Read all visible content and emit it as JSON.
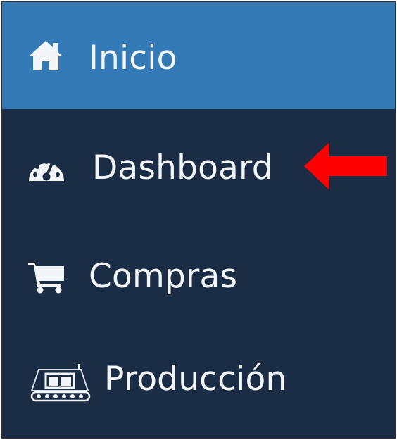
{
  "sidebar": {
    "items": [
      {
        "label": "Inicio",
        "icon": "home-icon",
        "active": true
      },
      {
        "label": "Dashboard",
        "icon": "dashboard-gauge-icon",
        "active": false
      },
      {
        "label": "Compras",
        "icon": "shopping-cart-icon",
        "active": false
      },
      {
        "label": "Producción",
        "icon": "production-conveyor-icon",
        "active": false
      }
    ]
  },
  "annotation": {
    "icon": "red-left-arrow-icon",
    "color": "#ff0000"
  },
  "colors": {
    "sidebar_background": "#1b2d45",
    "active_background": "#337ab7",
    "text": "#f3f6f9"
  }
}
